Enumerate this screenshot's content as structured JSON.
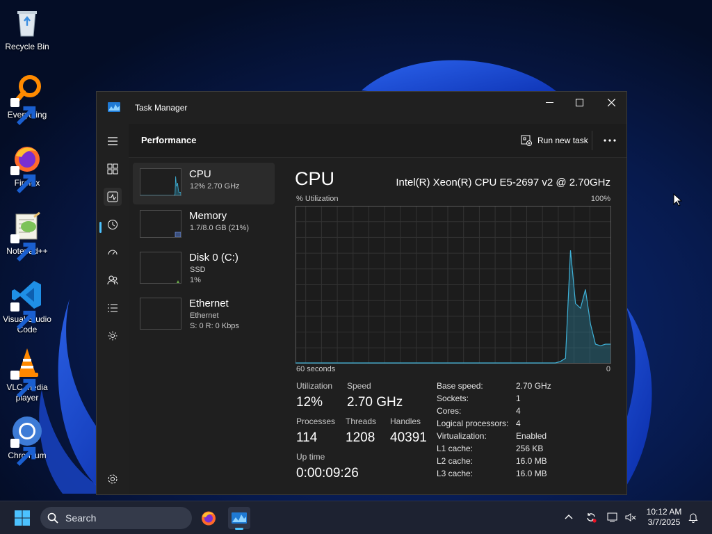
{
  "desktop": {
    "icons": [
      {
        "label": "Recycle Bin",
        "icon": "recycle-bin-icon"
      },
      {
        "label": "Everything",
        "icon": "everything-icon"
      },
      {
        "label": "Firefox",
        "icon": "firefox-icon"
      },
      {
        "label": "Notepad++",
        "icon": "notepad-plus-plus-icon"
      },
      {
        "label": "Visual Studio Code",
        "icon": "vscode-icon"
      },
      {
        "label": "VLC media player",
        "icon": "vlc-icon"
      },
      {
        "label": "Chromium",
        "icon": "chromium-icon"
      }
    ]
  },
  "window": {
    "title": "Task Manager",
    "accent": "#4cc2ff"
  },
  "commandbar": {
    "page_title": "Performance",
    "run_new_task": "Run new task"
  },
  "resources": [
    {
      "name": "CPU",
      "line1": "12% 2.70 GHz",
      "line2": ""
    },
    {
      "name": "Memory",
      "line1": "1.7/8.0 GB (21%)",
      "line2": ""
    },
    {
      "name": "Disk 0 (C:)",
      "line1": "SSD",
      "line2": "1%"
    },
    {
      "name": "Ethernet",
      "line1": "Ethernet",
      "line2": "S: 0 R: 0 Kbps"
    }
  ],
  "cpu": {
    "heading": "CPU",
    "model": "Intel(R) Xeon(R) CPU E5-2697 v2 @ 2.70GHz",
    "util_label": "% Utilization",
    "util_max": "100%",
    "axis_left": "60 seconds",
    "axis_right": "0",
    "graph_color": "#2d8fb0",
    "history": [
      0,
      0,
      0,
      0,
      0,
      0,
      0,
      0,
      0,
      0,
      0,
      0,
      0,
      0,
      0,
      0,
      0,
      0,
      0,
      0,
      0,
      0,
      0,
      0,
      0,
      0,
      0,
      0,
      0,
      0,
      0,
      0,
      0,
      0,
      0,
      0,
      0,
      0,
      0,
      0,
      0,
      0,
      0,
      0,
      0,
      0,
      0,
      0,
      0,
      0,
      0,
      0,
      0,
      1,
      3,
      72,
      38,
      35,
      47,
      25,
      12,
      11,
      12,
      12
    ]
  },
  "stats": {
    "utilization_label": "Utilization",
    "utilization_value": "12%",
    "speed_label": "Speed",
    "speed_value": "2.70 GHz",
    "processes_label": "Processes",
    "processes_value": "114",
    "threads_label": "Threads",
    "threads_value": "1208",
    "handles_label": "Handles",
    "handles_value": "40391",
    "uptime_label": "Up time",
    "uptime_value": "0:00:09:26"
  },
  "info": [
    {
      "label": "Base speed:",
      "value": "2.70 GHz"
    },
    {
      "label": "Sockets:",
      "value": "1"
    },
    {
      "label": "Cores:",
      "value": "4"
    },
    {
      "label": "Logical processors:",
      "value": "4"
    },
    {
      "label": "Virtualization:",
      "value": "Enabled"
    },
    {
      "label": "L1 cache:",
      "value": "256 KB"
    },
    {
      "label": "L2 cache:",
      "value": "16.0 MB"
    },
    {
      "label": "L3 cache:",
      "value": "16.0 MB"
    }
  ],
  "taskbar": {
    "search_placeholder": "Search",
    "time": "10:12 AM",
    "date": "3/7/2025"
  }
}
